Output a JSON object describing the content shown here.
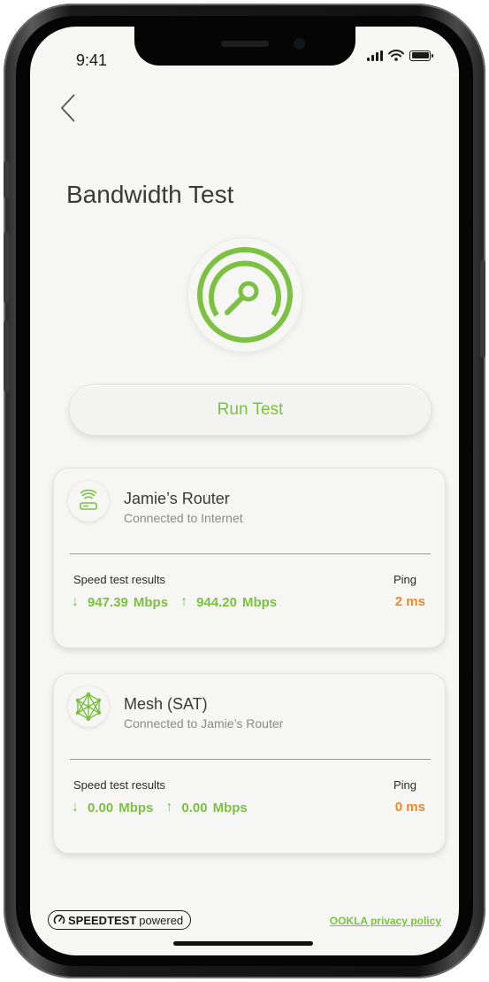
{
  "status_bar": {
    "time": "9:41"
  },
  "page": {
    "title": "Bandwidth Test"
  },
  "actions": {
    "run_test_label": "Run Test"
  },
  "devices": [
    {
      "name": "Jamie’s Router",
      "status": "Connected to Internet",
      "results_label": "Speed test results",
      "ping_label": "Ping",
      "download": "947.39",
      "upload": "944.20",
      "unit": "Mbps",
      "ping": "2 ms",
      "icon": "router-icon"
    },
    {
      "name": "Mesh (SAT)",
      "status": "Connected to Jamie’s Router",
      "results_label": "Speed test results",
      "ping_label": "Ping",
      "download": "0.00",
      "upload": "0.00",
      "unit": "Mbps",
      "ping": "0 ms",
      "icon": "mesh-network-icon"
    }
  ],
  "footer": {
    "speedtest": "SPEEDTEST",
    "powered": "powered",
    "privacy_link": "OOKLA privacy policy"
  },
  "colors": {
    "accent": "#7cc142",
    "ping": "#f08a24"
  }
}
